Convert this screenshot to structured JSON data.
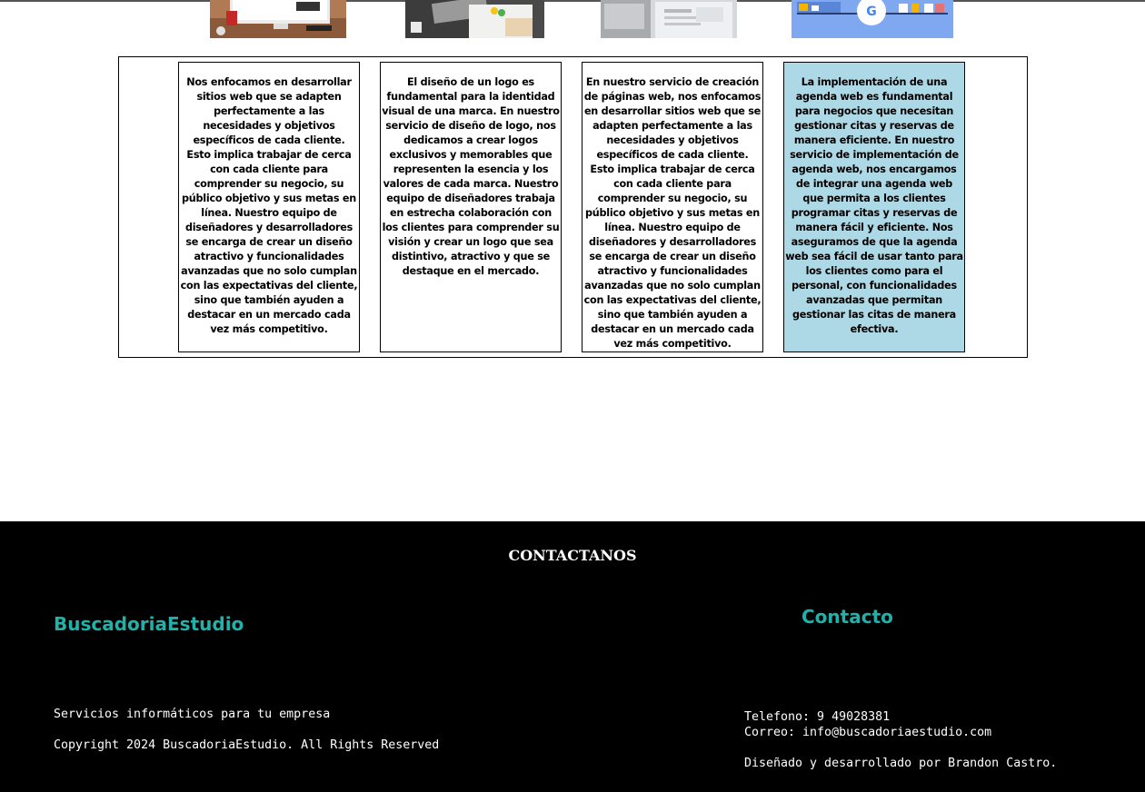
{
  "services": {
    "cards": [
      {
        "text": "Nos enfocamos en desarrollar sitios web que se adapten perfectamente a las necesidades y objetivos específicos de cada cliente. Esto implica trabajar de cerca con cada cliente para comprender su negocio, su público objetivo y sus metas en línea. Nuestro equipo de diseñadores y desarrolladores se encarga de crear un diseño atractivo y funcionalidades avanzadas que no solo cumplan con las expectativas del cliente, sino que también ayuden a destacar en un mercado cada vez más competitivo."
      },
      {
        "text": "El diseño de un logo es fundamental para la identidad visual de una marca. En nuestro servicio de diseño de logo, nos dedicamos a crear logos exclusivos y memorables que representen la esencia y los valores de cada marca. Nuestro equipo de diseñadores trabaja en estrecha colaboración con los clientes para comprender su visión y crear un logo que sea distintivo, atractivo y que se destaque en el mercado."
      },
      {
        "text": "En nuestro servicio de creación de páginas web, nos enfocamos en desarrollar sitios web que se adapten perfectamente a las necesidades y objetivos específicos de cada cliente. Esto implica trabajar de cerca con cada cliente para comprender su negocio, su público objetivo y sus metas en línea. Nuestro equipo de diseñadores y desarrolladores se encarga de crear un diseño atractivo y funcionalidades avanzadas que no solo cumplan con las expectativas del cliente, sino que también ayuden a destacar en un mercado cada vez más competitivo."
      },
      {
        "text": "La implementación de una agenda web es fundamental para negocios que necesitan gestionar citas y reservas de manera eficiente. En nuestro servicio de implementación de agenda web, nos encargamos de integrar una agenda web que permita a los clientes programar citas y reservas de manera fácil y eficiente. Nos aseguramos de que la agenda web sea fácil de usar tanto para los clientes como para el personal, con funcionalidades avanzadas que permitan gestionar las citas de manera efectiva."
      }
    ],
    "highlight_color": "#add8e6"
  },
  "footer": {
    "heading": "CONTACTANOS",
    "brand": "BuscadoriaEstudio",
    "contact_title": "Contacto",
    "tagline": "Servicios informáticos para tu empresa",
    "copyright": "Copyright 2024 BuscadoriaEstudio. All Rights Reserved",
    "phone": "Telefono: 9 49028381",
    "email": "Correo: info@buscadoriaestudio.com",
    "credit": "Diseñado y desarrollado por Brandon Castro.",
    "accent_color": "#20b2aa",
    "background": "#000000"
  }
}
